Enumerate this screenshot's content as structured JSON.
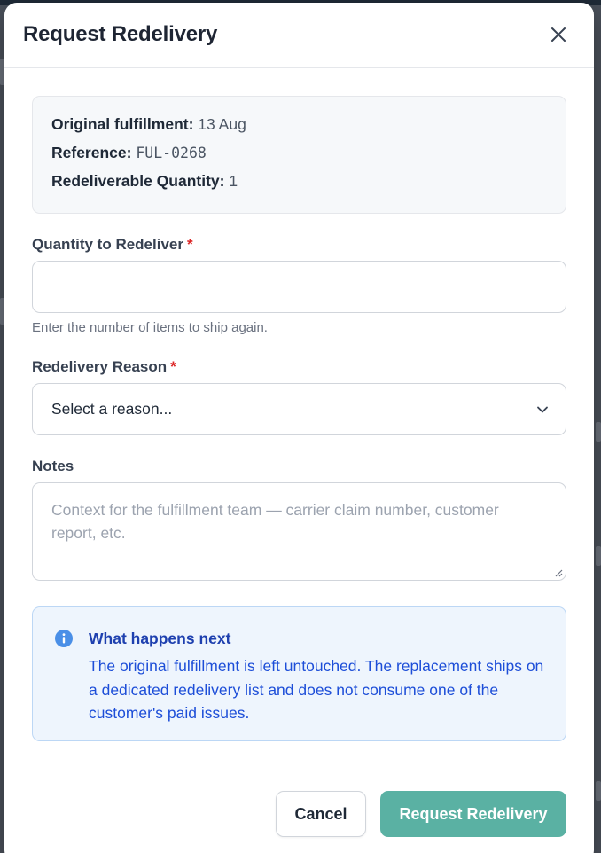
{
  "modal": {
    "title": "Request Redelivery",
    "close_icon": "close-icon"
  },
  "summary": {
    "original_fulfillment_label": "Original fulfillment:",
    "original_fulfillment_value": "13 Aug",
    "reference_label": "Reference:",
    "reference_value": "FUL-0268",
    "redeliverable_label": "Redeliverable Quantity:",
    "redeliverable_value": "1"
  },
  "quantity": {
    "label": "Quantity to Redeliver",
    "required_mark": "*",
    "value": "",
    "help": "Enter the number of items to ship again."
  },
  "reason": {
    "label": "Redelivery Reason",
    "required_mark": "*",
    "selected": "Select a reason..."
  },
  "notes": {
    "label": "Notes",
    "placeholder": "Context for the fulfillment team — carrier claim number, customer report, etc."
  },
  "alert": {
    "icon": "info-icon",
    "title": "What happens next",
    "body": "The original fulfillment is left untouched. The replacement ships on a dedicated redelivery list and does not consume one of the customer's paid issues."
  },
  "footer": {
    "cancel_label": "Cancel",
    "submit_label": "Request Redelivery"
  },
  "colors": {
    "primary": "#5ab1a3",
    "required": "#dc2626",
    "alert_bg": "#eef5fd",
    "alert_text": "#1d4ed8"
  }
}
